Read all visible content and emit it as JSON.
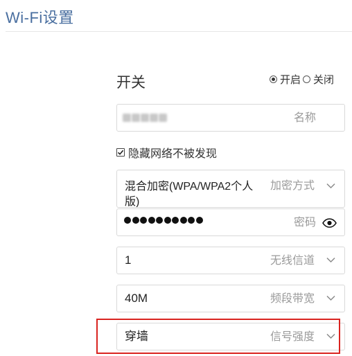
{
  "page": {
    "title": "Wi-Fi设置"
  },
  "switch": {
    "label": "开关",
    "options": [
      "开启",
      "关闭"
    ],
    "selected": "开启"
  },
  "wifi_name": {
    "hint": "名称",
    "value_redacted": true
  },
  "hide_network": {
    "label": "隐藏网络不被发现",
    "checked": true
  },
  "encryption": {
    "value_line1": "混合加密(WPA/WPA2个人",
    "value_line2": "版)",
    "hint": "加密方式"
  },
  "password": {
    "masked_length": 10,
    "hint": "密码"
  },
  "channel": {
    "value": "1",
    "hint": "无线信道"
  },
  "bandwidth": {
    "value": "40M",
    "hint": "频段带宽"
  },
  "signal": {
    "value": "穿墙",
    "hint": "信号强度",
    "highlighted": true,
    "highlight_color": "#d9231f"
  },
  "colors": {
    "title": "#4a6fa0",
    "hint": "#9a9a9a",
    "border": "#d9d9d9"
  },
  "icons": {
    "dropdown": "chevron-down-icon",
    "password_toggle": "eye-icon"
  }
}
